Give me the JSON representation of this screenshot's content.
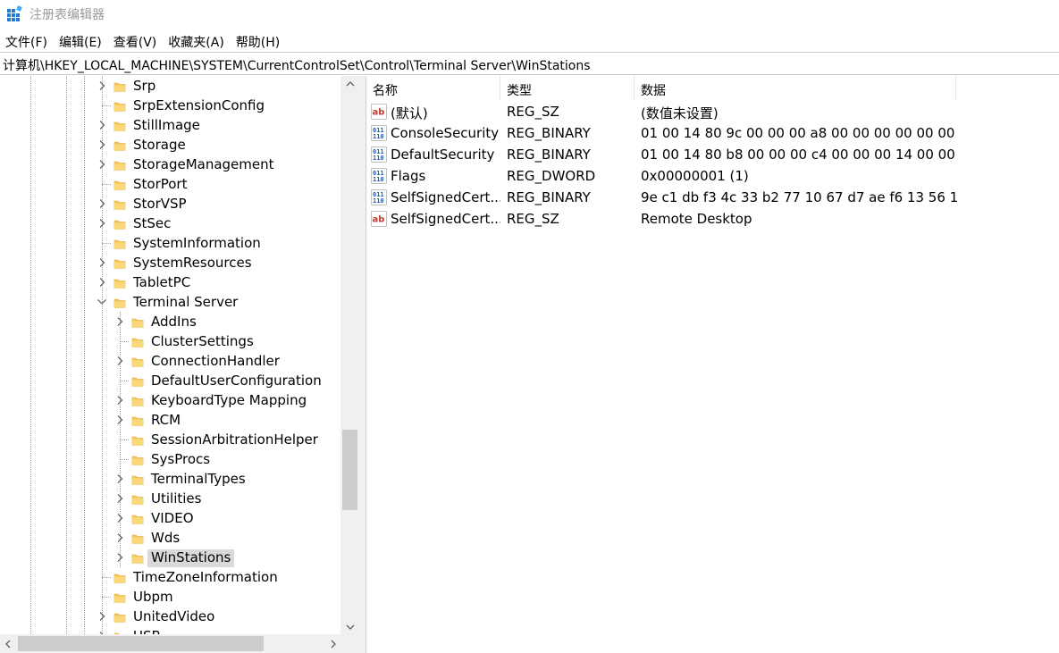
{
  "window": {
    "title": "注册表编辑器"
  },
  "menu": [
    "文件(F)",
    "编辑(E)",
    "查看(V)",
    "收藏夹(A)",
    "帮助(H)"
  ],
  "address": "计算机\\HKEY_LOCAL_MACHINE\\SYSTEM\\CurrentControlSet\\Control\\Terminal Server\\WinStations",
  "tree": {
    "items": [
      {
        "label": "Srp",
        "level": 0,
        "expander": "collapsed"
      },
      {
        "label": "SrpExtensionConfig",
        "level": 0,
        "expander": "none"
      },
      {
        "label": "StillImage",
        "level": 0,
        "expander": "collapsed"
      },
      {
        "label": "Storage",
        "level": 0,
        "expander": "collapsed"
      },
      {
        "label": "StorageManagement",
        "level": 0,
        "expander": "collapsed"
      },
      {
        "label": "StorPort",
        "level": 0,
        "expander": "none"
      },
      {
        "label": "StorVSP",
        "level": 0,
        "expander": "collapsed"
      },
      {
        "label": "StSec",
        "level": 0,
        "expander": "collapsed"
      },
      {
        "label": "SystemInformation",
        "level": 0,
        "expander": "none"
      },
      {
        "label": "SystemResources",
        "level": 0,
        "expander": "collapsed"
      },
      {
        "label": "TabletPC",
        "level": 0,
        "expander": "collapsed"
      },
      {
        "label": "Terminal Server",
        "level": 0,
        "expander": "expanded"
      },
      {
        "label": "AddIns",
        "level": 1,
        "expander": "collapsed"
      },
      {
        "label": "ClusterSettings",
        "level": 1,
        "expander": "none"
      },
      {
        "label": "ConnectionHandler",
        "level": 1,
        "expander": "collapsed"
      },
      {
        "label": "DefaultUserConfiguration",
        "level": 1,
        "expander": "none"
      },
      {
        "label": "KeyboardType Mapping",
        "level": 1,
        "expander": "collapsed"
      },
      {
        "label": "RCM",
        "level": 1,
        "expander": "collapsed"
      },
      {
        "label": "SessionArbitrationHelper",
        "level": 1,
        "expander": "none"
      },
      {
        "label": "SysProcs",
        "level": 1,
        "expander": "none"
      },
      {
        "label": "TerminalTypes",
        "level": 1,
        "expander": "collapsed"
      },
      {
        "label": "Utilities",
        "level": 1,
        "expander": "collapsed"
      },
      {
        "label": "VIDEO",
        "level": 1,
        "expander": "collapsed"
      },
      {
        "label": "Wds",
        "level": 1,
        "expander": "collapsed"
      },
      {
        "label": "WinStations",
        "level": 1,
        "expander": "collapsed",
        "selected": true
      },
      {
        "label": "TimeZoneInformation",
        "level": 0,
        "expander": "none"
      },
      {
        "label": "Ubpm",
        "level": 0,
        "expander": "none"
      },
      {
        "label": "UnitedVideo",
        "level": 0,
        "expander": "collapsed"
      },
      {
        "label": "USB",
        "level": 0,
        "expander": "collapsed"
      }
    ]
  },
  "list": {
    "columns": [
      "名称",
      "类型",
      "数据"
    ],
    "rows": [
      {
        "icon": "string-value-icon",
        "name": "(默认)",
        "type": "REG_SZ",
        "data": "(数值未设置)"
      },
      {
        "icon": "binary-value-icon",
        "name": "ConsoleSecurity",
        "type": "REG_BINARY",
        "data": "01 00 14 80 9c 00 00 00 a8 00 00 00 00 00 00 ..."
      },
      {
        "icon": "binary-value-icon",
        "name": "DefaultSecurity",
        "type": "REG_BINARY",
        "data": "01 00 14 80 b8 00 00 00 c4 00 00 00 14 00 00 ..."
      },
      {
        "icon": "binary-value-icon",
        "name": "Flags",
        "type": "REG_DWORD",
        "data": "0x00000001 (1)"
      },
      {
        "icon": "binary-value-icon",
        "name": "SelfSignedCert...",
        "type": "REG_BINARY",
        "data": "9e c1 db f3 4c 33 b2 77 10 67 d7 ae f6 13 56 1..."
      },
      {
        "icon": "string-value-icon",
        "name": "SelfSignedCert...",
        "type": "REG_SZ",
        "data": "Remote Desktop"
      }
    ]
  },
  "colors": {
    "selection": "#d9d9d9",
    "folder": "#f6c95a",
    "accent": "#1e7bd6"
  }
}
